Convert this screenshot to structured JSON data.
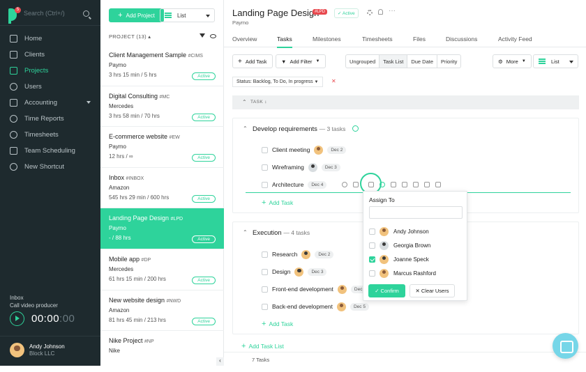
{
  "sidebar": {
    "search_placeholder": "Search (Ctrl+/)",
    "logo_badge": "5",
    "nav": [
      {
        "label": "Home",
        "icon": "home-icon"
      },
      {
        "label": "Clients",
        "icon": "clients-icon"
      },
      {
        "label": "Projects",
        "icon": "folder-icon",
        "active": true
      },
      {
        "label": "Users",
        "icon": "user-icon"
      },
      {
        "label": "Accounting",
        "icon": "accounting-icon"
      },
      {
        "label": "Time Reports",
        "icon": "clock-icon"
      },
      {
        "label": "Timesheets",
        "icon": "timesheet-icon"
      },
      {
        "label": "Team Scheduling",
        "icon": "calendar-icon"
      },
      {
        "label": "New Shortcut",
        "icon": "plus-circle-icon"
      }
    ],
    "timer": {
      "inbox": "Inbox",
      "task": "Call video producer",
      "time": "00:00",
      "seconds": ":00"
    },
    "user": {
      "name": "Andy Johnson",
      "company": "Block LLC"
    }
  },
  "projects": {
    "add_label": "Add Project",
    "view_label": "List",
    "header": "PROJECT (13) ▴",
    "items": [
      {
        "title": "Client Management Sample",
        "code": "#CIMS",
        "client": "Paymo",
        "hours": "3 hrs 15 min / 5 hrs",
        "status": "Active"
      },
      {
        "title": "Digital Consulting",
        "code": "#MC",
        "client": "Mercedes",
        "hours": "3 hrs 58 min / 70 hrs",
        "status": "Active"
      },
      {
        "title": "E-commerce website",
        "code": "#EW",
        "client": "Paymo",
        "hours": "12 hrs / ∞",
        "status": "Active"
      },
      {
        "title": "Inbox",
        "code": "#INBOX",
        "client": "Amazon",
        "hours": "545 hrs 29 min / 600 hrs",
        "status": "Active"
      },
      {
        "title": "Landing Page Design",
        "code": "#LPD",
        "client": "Paymo",
        "hours": "- / 88 hrs",
        "status": "Active"
      },
      {
        "title": "Mobile app",
        "code": "#DP",
        "client": "Mercedes",
        "hours": "61 hrs 15 min / 200 hrs",
        "status": "Active"
      },
      {
        "title": "New website design",
        "code": "#NWD",
        "client": "Amazon",
        "hours": "81 hrs 45 min / 213 hrs",
        "status": "Active"
      },
      {
        "title": "Nike Project",
        "code": "#NP",
        "client": "Nike",
        "hours": "",
        "status": ""
      }
    ]
  },
  "main": {
    "title": "Landing Page Design",
    "code": "#LPD",
    "status": "✓ Active",
    "client": "Paymo",
    "tabs": [
      "Overview",
      "Tasks",
      "Milestones",
      "Timesheets",
      "Files",
      "Discussions",
      "Activity Feed"
    ],
    "toolbar": {
      "add_task": "Add Task",
      "add_filter": "Add Filter",
      "views": [
        "Ungrouped",
        "Task List",
        "Due Date",
        "Priority"
      ],
      "more": "More",
      "list": "List"
    },
    "status_filter": "Status: Backlog, To Do, In progress",
    "table_header": "TASK ↕",
    "groups": [
      {
        "title": "Develop requirements",
        "count": "— 3 tasks",
        "tasks": [
          {
            "name": "Client meeting",
            "date": "Dec 2"
          },
          {
            "name": "Wireframing",
            "date": "Dec 3"
          },
          {
            "name": "Architecture",
            "date": "Dec 4"
          }
        ]
      },
      {
        "title": "Execution",
        "count": "— 4 tasks",
        "tasks": [
          {
            "name": "Research",
            "date": "Dec 2"
          },
          {
            "name": "Design",
            "date": "Dec 3"
          },
          {
            "name": "Front-end development",
            "date": "Dec 4"
          },
          {
            "name": "Back-end development",
            "date": "Dec 5"
          }
        ]
      }
    ],
    "add_task_label": "Add Task",
    "add_list_label": "Add Task List",
    "footer": "7 Tasks"
  },
  "assign": {
    "title": "Assign To",
    "users": [
      {
        "name": "Andy Johnson",
        "checked": false
      },
      {
        "name": "Georgia Brown",
        "checked": false
      },
      {
        "name": "Joanne Speck",
        "checked": true
      },
      {
        "name": "Marcus Rashford",
        "checked": false
      }
    ],
    "confirm": "✓ Confirm",
    "clear": "✕ Clear Users"
  },
  "colors": {
    "accent": "#2ed39b",
    "sidebar": "#1e2a2e",
    "danger": "#e8484e"
  }
}
